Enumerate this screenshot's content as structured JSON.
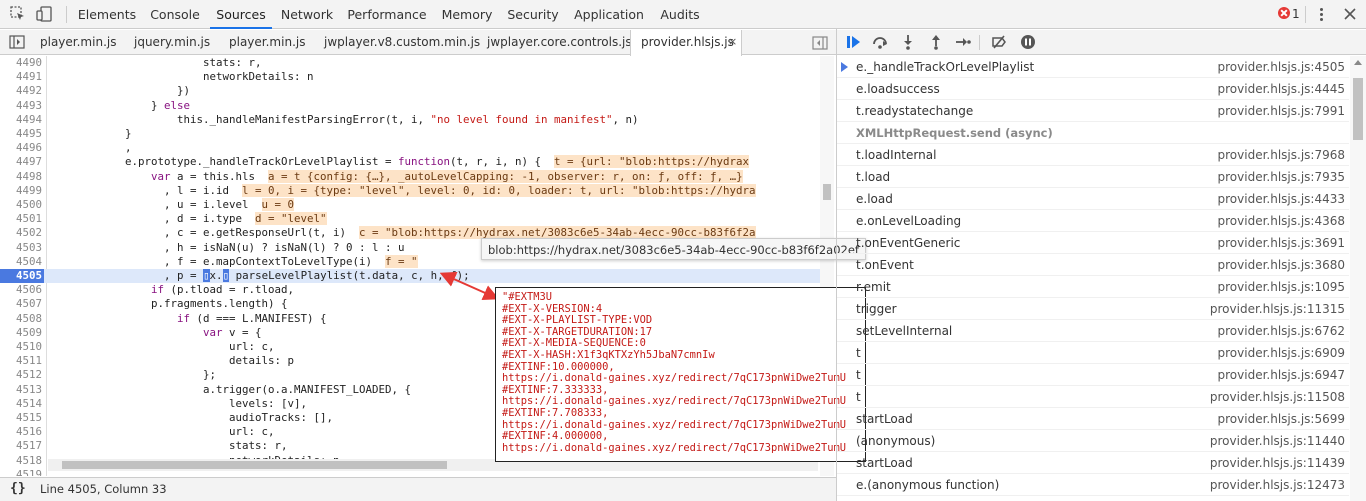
{
  "devtools_tabs": [
    "Elements",
    "Console",
    "Sources",
    "Network",
    "Performance",
    "Memory",
    "Security",
    "Application",
    "Audits"
  ],
  "active_tab": "Sources",
  "error_count": "1",
  "file_tabs": [
    "player.min.js",
    "jquery.min.js",
    "player.min.js",
    "jwplayer.v8.custom.min.js",
    "jwplayer.core.controls.js",
    "provider.hlsjs.js"
  ],
  "active_file": "provider.hlsjs.js",
  "file_close_glyph": "×",
  "code_lines": [
    {
      "n": "4490",
      "html": "                        stats: r,"
    },
    {
      "n": "4491",
      "html": "                        networkDetails: n"
    },
    {
      "n": "4492",
      "html": "                    })"
    },
    {
      "n": "4493",
      "html": "                } <span class=\"kw\">else</span>"
    },
    {
      "n": "4494",
      "html": "                    this._handleManifestParsingError(t, i, <span class=\"str\">\"no level found in manifest\"</span>, n)"
    },
    {
      "n": "4495",
      "html": "            }"
    },
    {
      "n": "4496",
      "html": "            ,"
    },
    {
      "n": "4497",
      "html": "            e.prototype._handleTrackOrLevelPlaylist = <span class=\"kw\">function</span>(t, r, i, n) {  <span class=\"inl\">t = {url: \"blob:https://hydrax</span>"
    },
    {
      "n": "4498",
      "html": "                <span class=\"kw\">var</span> a = this.hls  <span class=\"inl\">a = t {config: {…}, _autoLevelCapping: -1, observer: r, on: ƒ, off: ƒ, …}</span>"
    },
    {
      "n": "4499",
      "html": "                  , l = i.id  <span class=\"inl\">l = 0, i = {type: \"level\", level: 0, id: 0, loader: t, url: \"blob:https://hydra</span>"
    },
    {
      "n": "4500",
      "html": "                  , u = i.level  <span class=\"inl\">u = 0</span>"
    },
    {
      "n": "4501",
      "html": "                  , d = i.type  <span class=\"inl\">d = \"level\"</span>"
    },
    {
      "n": "4502",
      "html": "                  , c = e.getResponseUrl(t, i)  <span class=\"inl\">c = \"blob:https://hydrax.net/3083c6e5-34ab-4ecc-90cc-b83f6f2a</span>"
    },
    {
      "n": "4503",
      "html": "                  , h = isNaN(u) ? isNaN(l) ? 0 : l : u"
    },
    {
      "n": "4504",
      "html": "                  , f = e.mapContextToLevelType(i)  <span class=\"inl\">f = \"</span>"
    },
    {
      "n": "4505",
      "html": "                  , p = <span class=\"cursor-mark\">▯</span>x.<span class=\"cursor-mark\">▯</span> parseLevelPlaylist(t.data, c, h, f);",
      "hl": true
    },
    {
      "n": "4506",
      "html": "                <span class=\"kw\">if</span> (p.tload = r.tload,"
    },
    {
      "n": "4507",
      "html": "                p.fragments.length) {"
    },
    {
      "n": "4508",
      "html": "                    <span class=\"kw\">if</span> (d === L.MANIFEST) {"
    },
    {
      "n": "4509",
      "html": "                        <span class=\"kw\">var</span> v = {"
    },
    {
      "n": "4510",
      "html": "                            url: c,"
    },
    {
      "n": "4511",
      "html": "                            details: p"
    },
    {
      "n": "4512",
      "html": "                        };"
    },
    {
      "n": "4513",
      "html": "                        a.trigger(o.a.MANIFEST_LOADED, {"
    },
    {
      "n": "4514",
      "html": "                            levels: [v],"
    },
    {
      "n": "4515",
      "html": "                            audioTracks: [],"
    },
    {
      "n": "4516",
      "html": "                            url: c,"
    },
    {
      "n": "4517",
      "html": "                            stats: r,"
    },
    {
      "n": "4518",
      "html": "                            networkDetails: n"
    },
    {
      "n": "4519",
      "html": ""
    }
  ],
  "tooltip": "blob:https://hydrax.net/3083c6e5-34ab-4ecc-90cc-b83f6f2a02ef",
  "popup_lines": [
    "\"#EXTM3U",
    "#EXT-X-VERSION:4",
    "#EXT-X-PLAYLIST-TYPE:VOD",
    "#EXT-X-TARGETDURATION:17",
    "#EXT-X-MEDIA-SEQUENCE:0",
    "#EXT-X-HASH:X1f3qKTXzYh5JbaN7cmnIw",
    "#EXTINF:10.000000,",
    "https://i.donald-gaines.xyz/redirect/7qC173pnWiDwe2TumU",
    "#EXTINF:7.333333,",
    "https://i.donald-gaines.xyz/redirect/7qC173pnWiDwe2TumU",
    "#EXTINF:7.708333,",
    "https://i.donald-gaines.xyz/redirect/7qC173pnWiDwe2TumU",
    "#EXTINF:4.000000,",
    "https://i.donald-gaines.xyz/redirect/7qC173pnWiDwe2TumU"
  ],
  "status_braces": "{}",
  "status_text": "Line 4505, Column 33",
  "call_stack": [
    {
      "fn": "e._handleTrackOrLevelPlaylist",
      "loc": "provider.hlsjs.js:4505",
      "current": true
    },
    {
      "fn": "e.loadsuccess",
      "loc": "provider.hlsjs.js:4445"
    },
    {
      "fn": "t.readystatechange",
      "loc": "provider.hlsjs.js:7991"
    },
    {
      "fn": "XMLHttpRequest.send (async)",
      "loc": "",
      "async": true
    },
    {
      "fn": "t.loadInternal",
      "loc": "provider.hlsjs.js:7968"
    },
    {
      "fn": "t.load",
      "loc": "provider.hlsjs.js:7935"
    },
    {
      "fn": "e.load",
      "loc": "provider.hlsjs.js:4433"
    },
    {
      "fn": "e.onLevelLoading",
      "loc": "provider.hlsjs.js:4368"
    },
    {
      "fn": "t.onEventGeneric",
      "loc": "provider.hlsjs.js:3691"
    },
    {
      "fn": "t.onEvent",
      "loc": "provider.hlsjs.js:3680"
    },
    {
      "fn": "r.emit",
      "loc": "provider.hlsjs.js:1095"
    },
    {
      "fn": "trigger",
      "loc": "provider.hlsjs.js:11315"
    },
    {
      "fn": "setLevelInternal",
      "loc": "provider.hlsjs.js:6762"
    },
    {
      "fn": "t",
      "loc": "provider.hlsjs.js:6909"
    },
    {
      "fn": "t",
      "loc": "provider.hlsjs.js:6947"
    },
    {
      "fn": "t",
      "loc": "provider.hlsjs.js:11508"
    },
    {
      "fn": "startLoad",
      "loc": "provider.hlsjs.js:5699"
    },
    {
      "fn": "(anonymous)",
      "loc": "provider.hlsjs.js:11440"
    },
    {
      "fn": "startLoad",
      "loc": "provider.hlsjs.js:11439"
    },
    {
      "fn": "e.(anonymous function)",
      "loc": "provider.hlsjs.js:12473"
    }
  ],
  "colors": {
    "accent": "#1a73e8",
    "current_line": "#4a79e0",
    "string": "#c41a16",
    "annotation_red": "#e53935"
  }
}
